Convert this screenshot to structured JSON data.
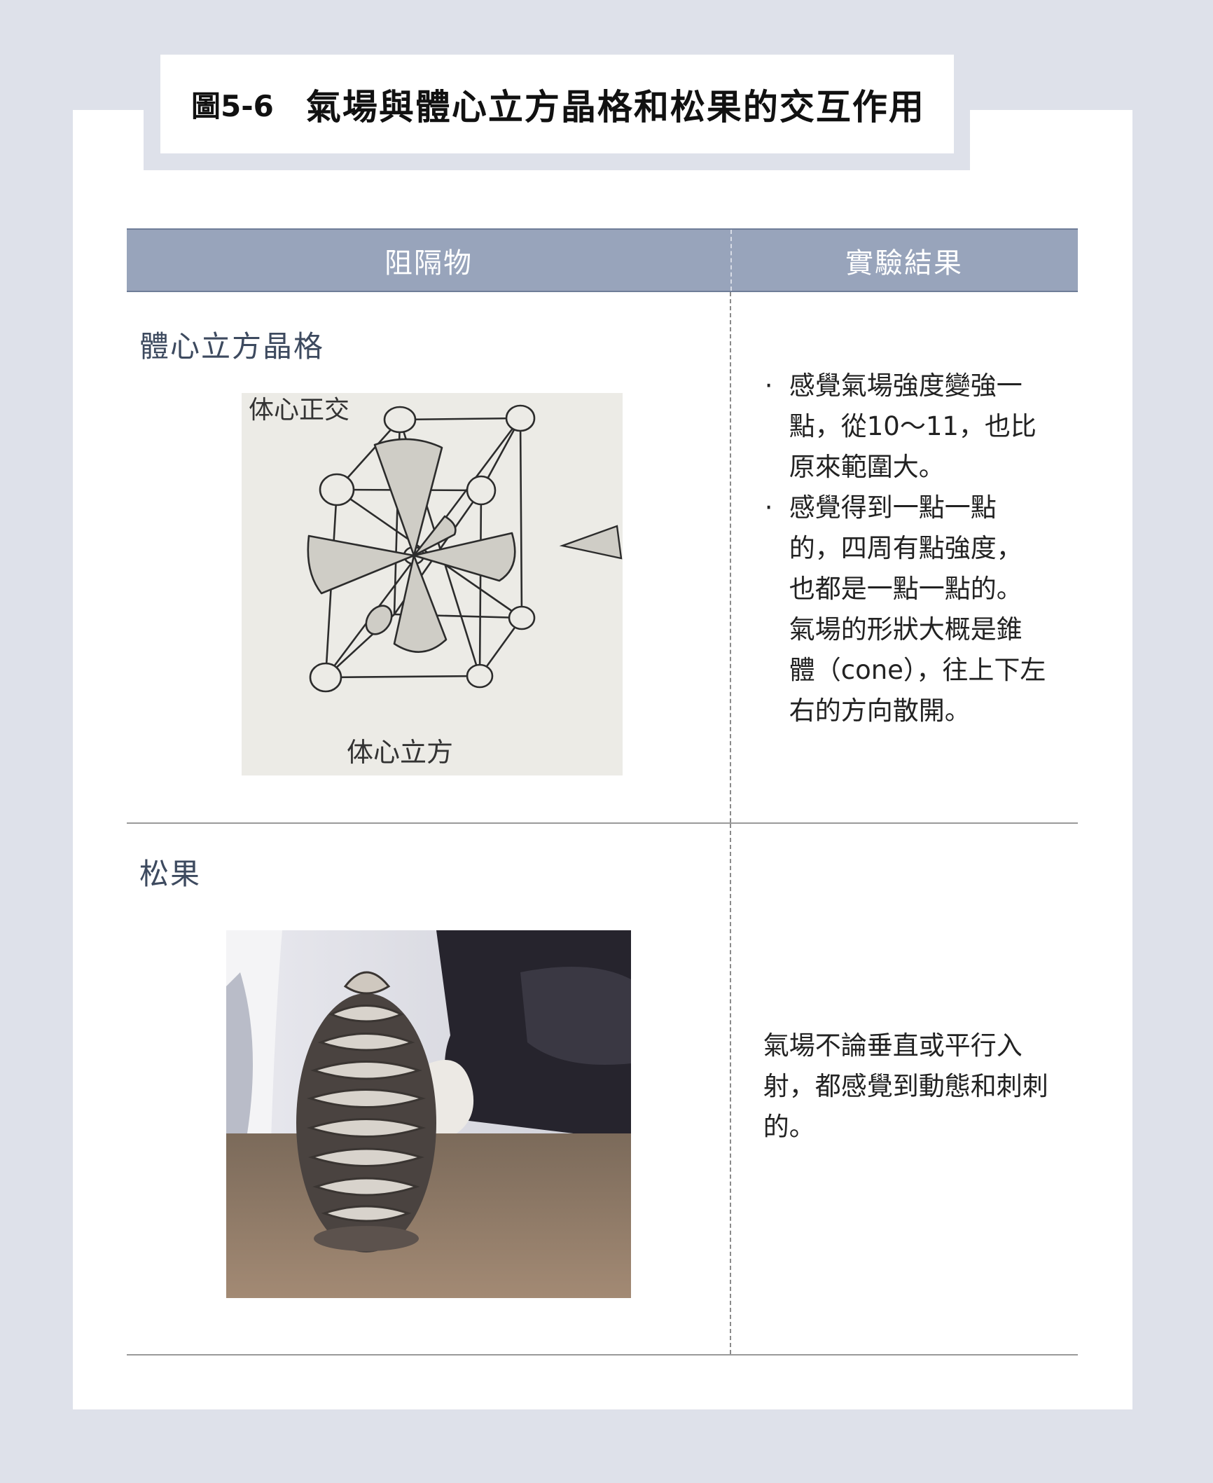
{
  "figure": {
    "number": "圖5-6",
    "title": "氣場與體心立方晶格和松果的交互作用"
  },
  "table": {
    "headers": {
      "obstacle": "阻隔物",
      "result": "實驗結果"
    },
    "rows": [
      {
        "obstacle": "體心立方晶格",
        "sketch_labels": {
          "top": "体心正交",
          "bottom": "体心立方"
        },
        "results": [
          "感覺氣場強度變強一點，從10～11，也比原來範圍大。",
          "感覺得到一點一點的，四周有點強度，也都是一點一點的。氣場的形狀大概是錐體（cone），往上下左右的方向散開。"
        ]
      },
      {
        "obstacle": "松果",
        "result": "氣場不論垂直或平行入射，都感覺到動態和刺刺的。"
      }
    ]
  }
}
